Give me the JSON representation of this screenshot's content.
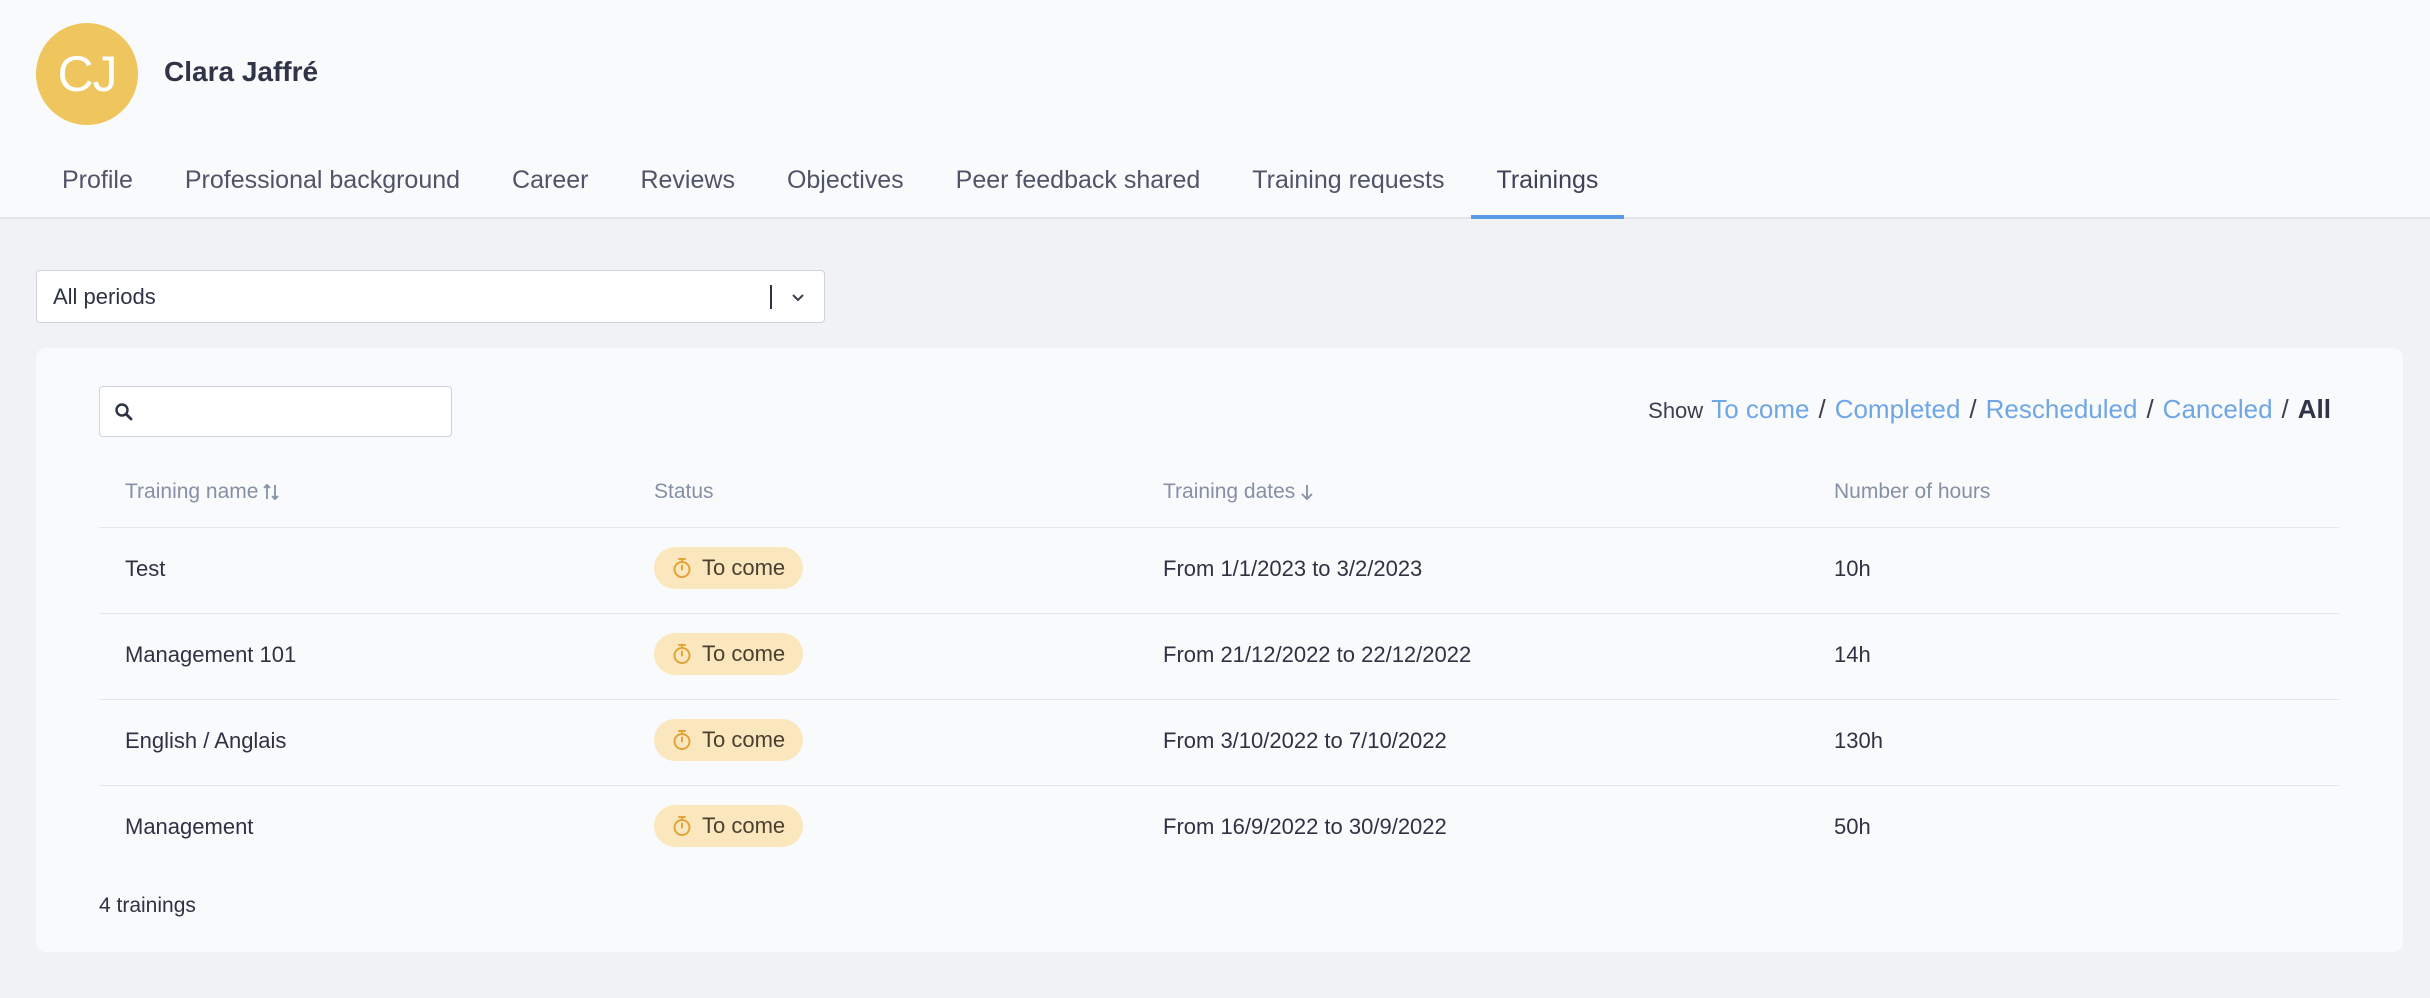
{
  "user": {
    "initials": "CJ",
    "name": "Clara Jaffré"
  },
  "tabs": [
    {
      "label": "Profile"
    },
    {
      "label": "Professional background"
    },
    {
      "label": "Career"
    },
    {
      "label": "Reviews"
    },
    {
      "label": "Objectives"
    },
    {
      "label": "Peer feedback shared"
    },
    {
      "label": "Training requests"
    },
    {
      "label": "Trainings",
      "active": true
    }
  ],
  "period_filter": {
    "value": "All periods"
  },
  "search": {
    "placeholder": "",
    "value": ""
  },
  "show_filter": {
    "label": "Show",
    "options": [
      "To come",
      "Completed",
      "Rescheduled",
      "Canceled",
      "All"
    ],
    "selected": "All",
    "link_color": "#6fa6e4"
  },
  "table": {
    "columns": {
      "name": "Training name",
      "status": "Status",
      "dates": "Training dates",
      "hours": "Number of hours"
    },
    "rows": [
      {
        "name": "Test",
        "status": "To come",
        "dates": "From 1/1/2023 to 3/2/2023",
        "hours": "10h"
      },
      {
        "name": "Management 101",
        "status": "To come",
        "dates": "From 21/12/2022 to 22/12/2022",
        "hours": "14h"
      },
      {
        "name": "English / Anglais",
        "status": "To come",
        "dates": "From 3/10/2022 to 7/10/2022",
        "hours": "130h"
      },
      {
        "name": "Management",
        "status": "To come",
        "dates": "From 16/9/2022 to 30/9/2022",
        "hours": "50h"
      }
    ]
  },
  "footer": {
    "count_text": "4 trainings"
  },
  "colors": {
    "avatar": "#efc65e",
    "active_tab_underline": "#5a9ce6",
    "status_badge_bg": "#fbe7bd",
    "status_icon": "#e0a43a"
  },
  "icons": {
    "search": "search-icon",
    "dropdown": "chevron-down-icon",
    "sort_both": "sort-icon",
    "sort_desc": "arrow-down-icon",
    "status": "stopwatch-icon"
  }
}
